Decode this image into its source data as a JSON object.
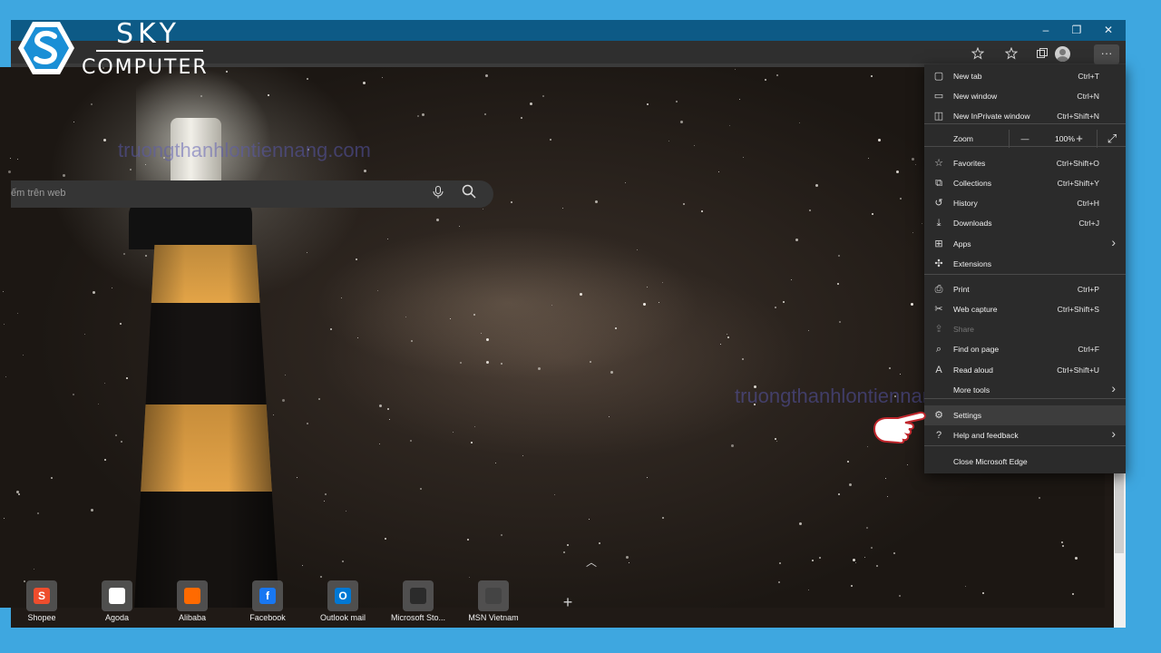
{
  "logo": {
    "line1": "SKY",
    "line2": "COMPUTER"
  },
  "window_controls": {
    "minimize": "–",
    "restore": "❐",
    "close": "✕"
  },
  "toolbar": {
    "add_favorite_icon": "star-plus-icon",
    "favorites_icon": "favorites-icon",
    "collections_icon": "collections-icon",
    "profile_icon": "profile-icon",
    "more_icon": "ellipsis-icon",
    "more_label": "···"
  },
  "watermarks": [
    "truongthanhlontiennang.com",
    "truongthanhlontiennang.com"
  ],
  "search": {
    "placeholder": "ếm trên web"
  },
  "quick_links": [
    {
      "label": "Shopee",
      "color": "#ee4d2d",
      "glyph": "S"
    },
    {
      "label": "Agoda",
      "color": "#ffffff",
      "glyph": ""
    },
    {
      "label": "Alibaba",
      "color": "#ff6a00",
      "glyph": ""
    },
    {
      "label": "Facebook",
      "color": "#1877f2",
      "glyph": "f"
    },
    {
      "label": "Outlook mail",
      "color": "#0078d4",
      "glyph": "O"
    },
    {
      "label": "Microsoft Sto...",
      "color": "#2b2b2b",
      "glyph": ""
    },
    {
      "label": "MSN Vietnam",
      "color": "#444444",
      "glyph": ""
    }
  ],
  "menu": {
    "items": [
      {
        "label": "New tab",
        "shortcut": "Ctrl+T",
        "icon": "new-tab-icon"
      },
      {
        "label": "New window",
        "shortcut": "Ctrl+N",
        "icon": "new-window-icon"
      },
      {
        "label": "New InPrivate window",
        "shortcut": "Ctrl+Shift+N",
        "icon": "inprivate-icon"
      },
      {
        "label": "Zoom",
        "zoom_value": "100%",
        "icon": "zoom-icon"
      },
      {
        "label": "Favorites",
        "shortcut": "Ctrl+Shift+O",
        "icon": "favorites-icon"
      },
      {
        "label": "Collections",
        "shortcut": "Ctrl+Shift+Y",
        "icon": "collections-icon"
      },
      {
        "label": "History",
        "shortcut": "Ctrl+H",
        "icon": "history-icon"
      },
      {
        "label": "Downloads",
        "shortcut": "Ctrl+J",
        "icon": "download-icon"
      },
      {
        "label": "Apps",
        "shortcut": "",
        "icon": "apps-icon",
        "submenu": true
      },
      {
        "label": "Extensions",
        "shortcut": "",
        "icon": "extensions-icon"
      },
      {
        "label": "Print",
        "shortcut": "Ctrl+P",
        "icon": "print-icon"
      },
      {
        "label": "Web capture",
        "shortcut": "Ctrl+Shift+S",
        "icon": "web-capture-icon"
      },
      {
        "label": "Share",
        "shortcut": "",
        "icon": "share-icon",
        "disabled": true
      },
      {
        "label": "Find on page",
        "shortcut": "Ctrl+F",
        "icon": "find-icon"
      },
      {
        "label": "Read aloud",
        "shortcut": "Ctrl+Shift+U",
        "icon": "read-aloud-icon"
      },
      {
        "label": "More tools",
        "shortcut": "",
        "icon": "more-tools-icon",
        "submenu": true
      },
      {
        "label": "Settings",
        "shortcut": "",
        "icon": "settings-gear-icon",
        "highlighted": true
      },
      {
        "label": "Help and feedback",
        "shortcut": "",
        "icon": "help-icon",
        "submenu": true
      },
      {
        "label": "Close Microsoft Edge",
        "shortcut": ""
      }
    ]
  }
}
